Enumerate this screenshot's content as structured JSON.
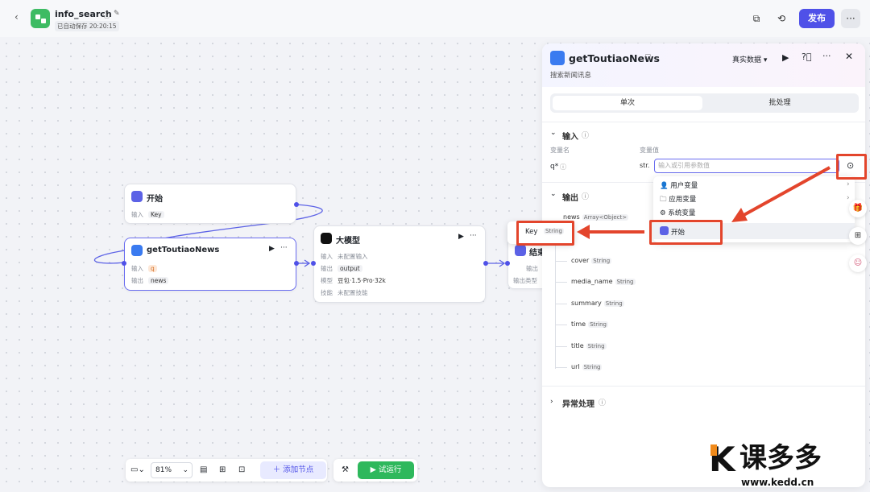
{
  "header": {
    "back_icon": "chevron-left-icon",
    "app_name": "info_search",
    "saved_status": "已自动保存 20:20:15",
    "publish_label": "发布",
    "more_label": "···"
  },
  "canvas": {
    "start_node": {
      "title": "开始",
      "input_label": "输入",
      "input_value": "Key"
    },
    "tool_node": {
      "title": "getToutiaoNews",
      "input_label": "输入",
      "input_value": "q",
      "output_label": "输出",
      "output_value": "news",
      "run_icon": "▶",
      "more": "···"
    },
    "llm_node": {
      "title": "大模型",
      "input_label": "输入",
      "input_value": "未配置输入",
      "output_label": "输出",
      "output_value": "output",
      "model_label": "模型",
      "model_value": "豆包·1.5·Pro·32k",
      "skill_label": "技能",
      "skill_value": "未配置技能",
      "run_icon": "▶",
      "more": "···"
    },
    "end_node": {
      "title": "结束",
      "output_label": "输出",
      "output_type_label": "输出类型"
    },
    "key_popover": {
      "name": "Key",
      "type": "String"
    }
  },
  "panel": {
    "title": "getToutiaoNews",
    "description": "搜索新闻讯息",
    "data_mode": "真实数据",
    "tabs": [
      "单次",
      "批处理"
    ],
    "input_section": "输入",
    "col_var_name": "变量名",
    "col_var_value": "变量值",
    "param_name": "q*",
    "param_type": "str.",
    "param_placeholder": "输入或引用参数值",
    "output_section": "输出",
    "output_root": {
      "name": "news",
      "type": "Array<Object>"
    },
    "output_fields": [
      {
        "name": "cover",
        "type": "String"
      },
      {
        "name": "media_name",
        "type": "String"
      },
      {
        "name": "summary",
        "type": "String"
      },
      {
        "name": "time",
        "type": "String"
      },
      {
        "name": "title",
        "type": "String"
      },
      {
        "name": "url",
        "type": "String"
      }
    ],
    "exception_section": "异常处理"
  },
  "dropdown": {
    "items": [
      "用户变量",
      "应用变量",
      "系统变量"
    ],
    "start_item": "开始"
  },
  "toolbar": {
    "zoom": "81%",
    "add_node": "添加节点",
    "test_run": "试运行"
  },
  "watermark": {
    "brand": "课多多",
    "url": "www.kedd.cn"
  },
  "colors": {
    "accent": "#4f51e8",
    "highlight": "#e3452c",
    "run": "#2eb85c"
  }
}
